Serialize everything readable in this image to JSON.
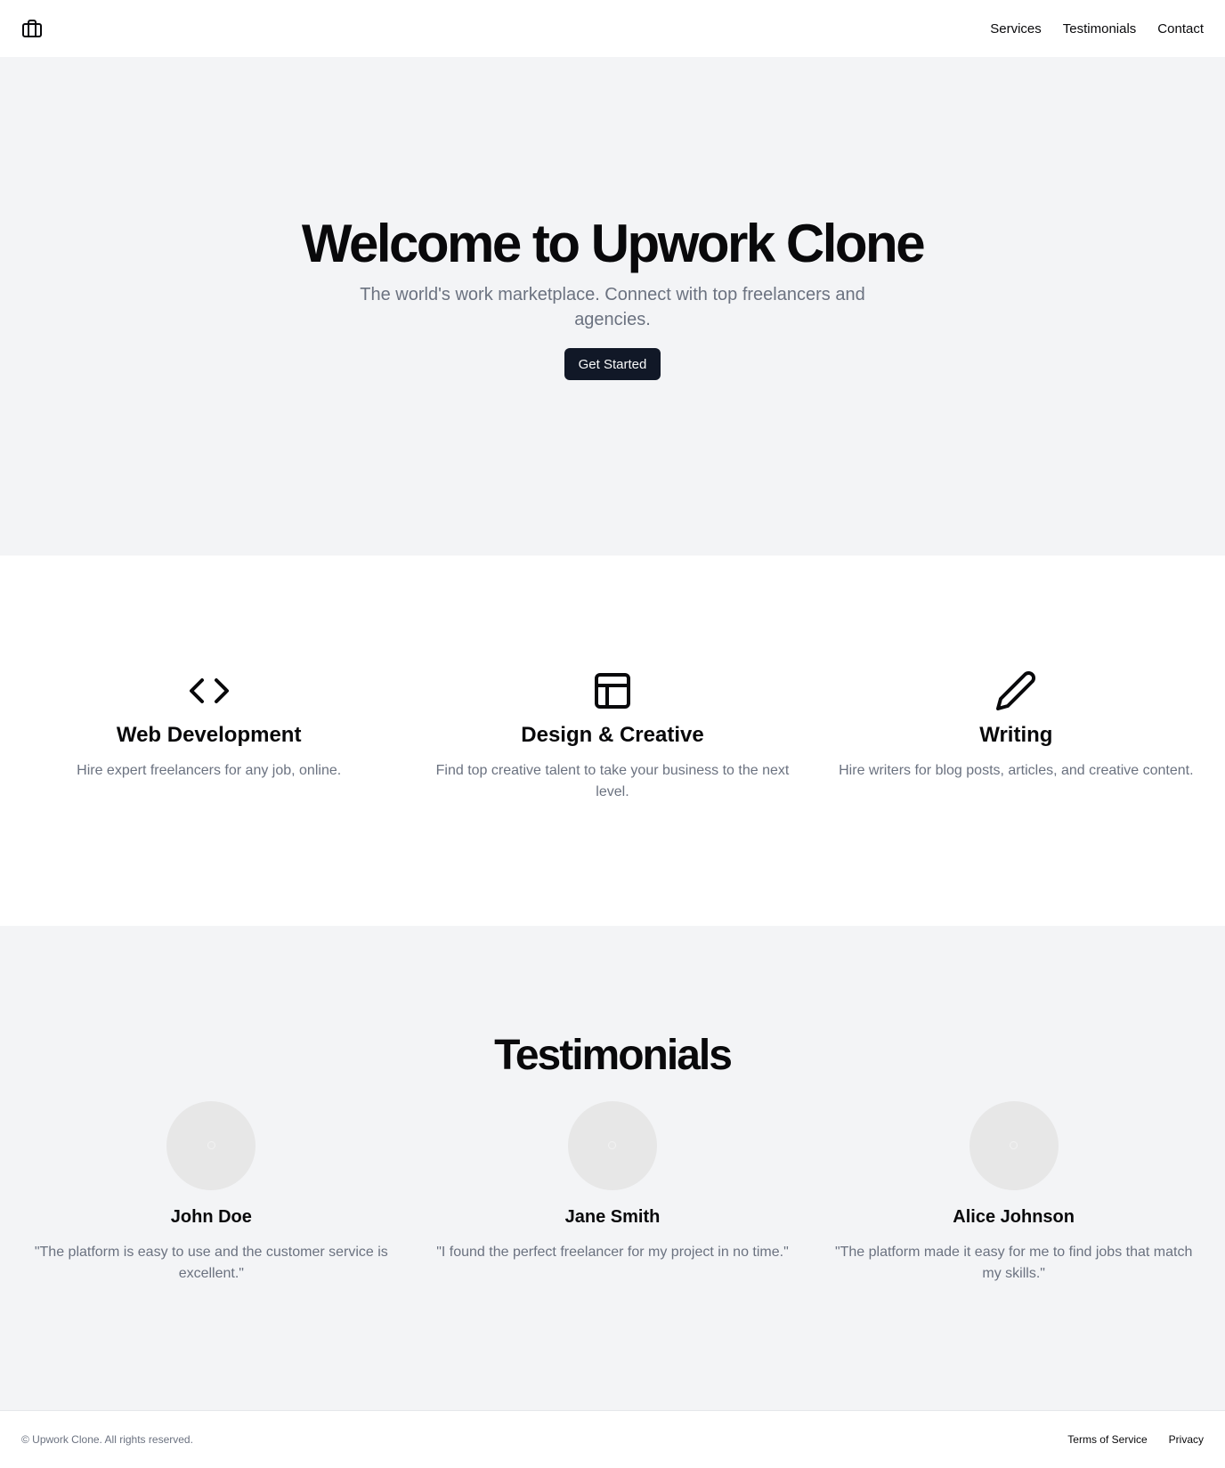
{
  "header": {
    "logo_icon": "briefcase-icon",
    "nav": [
      "Services",
      "Testimonials",
      "Contact"
    ]
  },
  "hero": {
    "title": "Welcome to Upwork Clone",
    "subtitle": "The world's work marketplace. Connect with top freelancers and agencies.",
    "cta_label": "Get Started"
  },
  "services": [
    {
      "icon": "code-icon",
      "title": "Web Development",
      "description": "Hire expert freelancers for any job, online."
    },
    {
      "icon": "layout-icon",
      "title": "Design & Creative",
      "description": "Find top creative talent to take your business to the next level."
    },
    {
      "icon": "pencil-icon",
      "title": "Writing",
      "description": "Hire writers for blog posts, articles, and creative content."
    }
  ],
  "testimonials": {
    "title": "Testimonials",
    "items": [
      {
        "name": "John Doe",
        "quote": "\"The platform is easy to use and the customer service is excellent.\""
      },
      {
        "name": "Jane Smith",
        "quote": "\"I found the perfect freelancer for my project in no time.\""
      },
      {
        "name": "Alice Johnson",
        "quote": "\"The platform made it easy for me to find jobs that match my skills.\""
      }
    ]
  },
  "footer": {
    "copyright": "© Upwork Clone. All rights reserved.",
    "links": [
      "Terms of Service",
      "Privacy"
    ]
  },
  "colors": {
    "primary": "#111827",
    "muted_text": "#6b7280",
    "section_bg": "#f3f4f6",
    "avatar_bg": "#e7e7e7"
  }
}
